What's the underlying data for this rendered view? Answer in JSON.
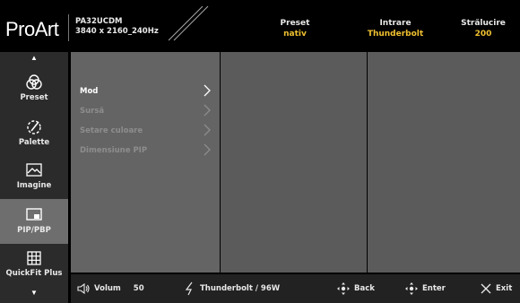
{
  "header": {
    "logo": "ProArt",
    "model": "PA32UCDM",
    "resolution": "3840 x 2160_240Hz",
    "preset_label": "Preset",
    "preset_value": "nativ",
    "input_label": "Intrare",
    "input_value": "Thunderbolt",
    "brightness_label": "Strălucire",
    "brightness_value": "200",
    "accent_color": "#f0c030"
  },
  "sidebar": {
    "items": [
      {
        "label": "Preset",
        "icon": "preset-icon"
      },
      {
        "label": "Palette",
        "icon": "palette-icon"
      },
      {
        "label": "Imagine",
        "icon": "image-icon"
      },
      {
        "label": "PIP/PBP",
        "icon": "pip-pbp-icon",
        "selected": true
      },
      {
        "label": "QuickFit Plus",
        "icon": "grid-icon"
      }
    ]
  },
  "menu": {
    "items": [
      {
        "label": "Mod",
        "enabled": true
      },
      {
        "label": "Sursă",
        "enabled": false
      },
      {
        "label": "Setare culoare",
        "enabled": false
      },
      {
        "label": "Dimensiune PIP",
        "enabled": false
      }
    ]
  },
  "footer": {
    "volume_label": "Volum",
    "volume_value": "50",
    "power_source": "Thunderbolt / 96W",
    "back_label": "Back",
    "enter_label": "Enter",
    "exit_label": "Exit"
  }
}
